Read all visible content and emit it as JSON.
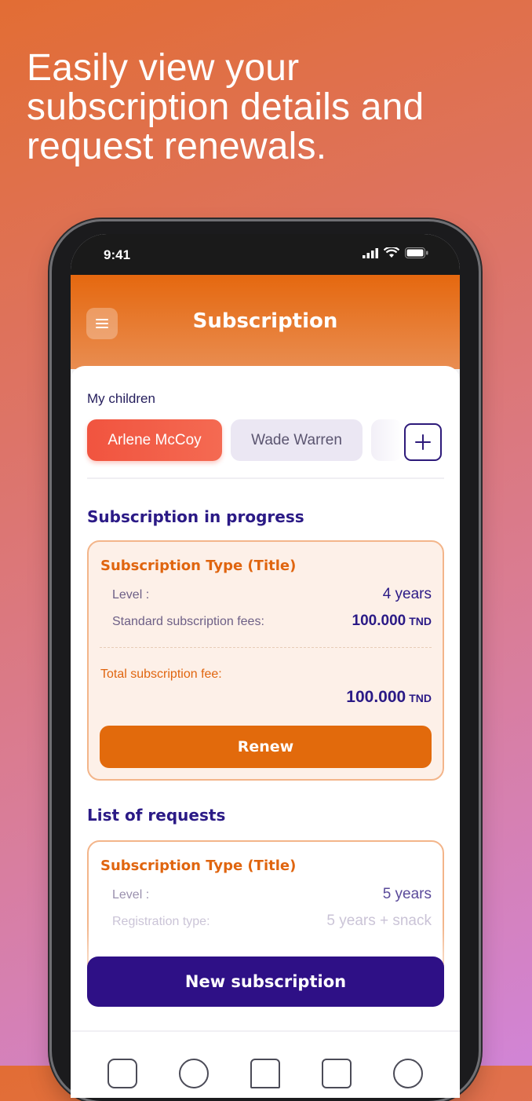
{
  "headline": "Easily view your\nsubscription details and\nrequest renewals.",
  "status_bar": {
    "time": "9:41"
  },
  "header": {
    "title": "Subscription",
    "menu_icon": "hamburger-icon"
  },
  "children": {
    "label": "My children",
    "items": [
      "Arlene McCoy",
      "Wade Warren"
    ],
    "selected": "Arlene McCoy",
    "add_icon": "plus-icon"
  },
  "in_progress": {
    "section_title": "Subscription in progress",
    "card": {
      "title": "Subscription Type (Title)",
      "level_label": "Level :",
      "level_value": "4 years",
      "fees_label": "Standard subscription fees:",
      "fees_value": "100.000",
      "currency": "TND",
      "total_label": "Total subscription fee:",
      "total_value": "100.000",
      "button": "Renew"
    }
  },
  "requests": {
    "section_title": "List of requests",
    "card": {
      "title": "Subscription Type (Title)",
      "level_label": "Level :",
      "level_value": "5 years",
      "reg_label": "Registration type:",
      "reg_value": "5 years + snack"
    }
  },
  "new_subscription_button": "New subscription",
  "colors": {
    "accent": "#e26a0c",
    "primary": "#2e1086",
    "chip_active": "#f1543f"
  }
}
